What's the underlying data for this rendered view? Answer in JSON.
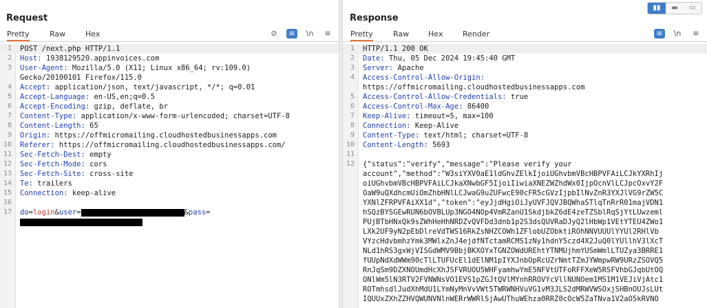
{
  "view_toggle": [
    {
      "name": "side-by-side-view-icon",
      "glyph": "▮▮",
      "active": true
    },
    {
      "name": "top-bottom-view-icon",
      "glyph": "▬",
      "active": false
    },
    {
      "name": "single-view-icon",
      "glyph": "▭",
      "active": false
    }
  ],
  "request": {
    "title": "Request",
    "tabs": [
      "Pretty",
      "Raw",
      "Hex"
    ],
    "active_tab": 0,
    "tools": [
      {
        "name": "hide-nonprintable-icon",
        "glyph": "⊘",
        "blue": false
      },
      {
        "name": "message-actions-icon",
        "glyph": "≡",
        "blue": true
      },
      {
        "name": "newline-toggle-icon",
        "glyph": "\\n",
        "blue": false
      },
      {
        "name": "menu-icon",
        "glyph": "≡",
        "blue": false
      }
    ],
    "lines": [
      {
        "n": "1",
        "parts": [
          {
            "t": "POST /next.php HTTP/1.1"
          }
        ],
        "hl": true
      },
      {
        "n": "2",
        "parts": [
          {
            "t": "Host:",
            "c": "key"
          },
          {
            "t": " 1938129520.appinvoices.com"
          }
        ]
      },
      {
        "n": "3",
        "parts": [
          {
            "t": "User-Agent:",
            "c": "key"
          },
          {
            "t": " Mozilla/5.0 (X11; Linux x86_64; rv:109.0)"
          }
        ]
      },
      {
        "n": "",
        "parts": [
          {
            "t": "Gecko/20100101 Firefox/115.0"
          }
        ]
      },
      {
        "n": "4",
        "parts": [
          {
            "t": "Accept:",
            "c": "key"
          },
          {
            "t": " application/json, text/javascript, */*; q=0.01"
          }
        ]
      },
      {
        "n": "5",
        "parts": [
          {
            "t": "Accept-Language:",
            "c": "key"
          },
          {
            "t": " en-US,en;q=0.5"
          }
        ]
      },
      {
        "n": "6",
        "parts": [
          {
            "t": "Accept-Encoding:",
            "c": "key"
          },
          {
            "t": " gzip, deflate, br"
          }
        ]
      },
      {
        "n": "7",
        "parts": [
          {
            "t": "Content-Type:",
            "c": "key"
          },
          {
            "t": " application/x-www-form-urlencoded; charset=UTF-8"
          }
        ]
      },
      {
        "n": "8",
        "parts": [
          {
            "t": "Content-Length:",
            "c": "key"
          },
          {
            "t": " 65"
          }
        ]
      },
      {
        "n": "9",
        "parts": [
          {
            "t": "Origin:",
            "c": "key"
          },
          {
            "t": " https://offmicromailing.cloudhostedbusinessapps.com"
          }
        ]
      },
      {
        "n": "10",
        "parts": [
          {
            "t": "Referer:",
            "c": "key"
          },
          {
            "t": " https://offmicromailing.cloudhostedbusinessapps.com/"
          }
        ]
      },
      {
        "n": "11",
        "parts": [
          {
            "t": "Sec-Fetch-Dest:",
            "c": "key"
          },
          {
            "t": " empty"
          }
        ]
      },
      {
        "n": "12",
        "parts": [
          {
            "t": "Sec-Fetch-Mode:",
            "c": "key"
          },
          {
            "t": " cors"
          }
        ]
      },
      {
        "n": "13",
        "parts": [
          {
            "t": "Sec-Fetch-Site:",
            "c": "key"
          },
          {
            "t": " cross-site"
          }
        ]
      },
      {
        "n": "14",
        "parts": [
          {
            "t": "Te:",
            "c": "key"
          },
          {
            "t": " trailers"
          }
        ]
      },
      {
        "n": "15",
        "parts": [
          {
            "t": "Connection:",
            "c": "key"
          },
          {
            "t": " keep-alive"
          }
        ]
      },
      {
        "n": "16",
        "parts": []
      },
      {
        "n": "17",
        "parts": [
          {
            "t": "do",
            "c": "key"
          },
          {
            "t": "="
          },
          {
            "t": "login",
            "c": "param"
          },
          {
            "t": "&"
          },
          {
            "t": "user",
            "c": "key"
          },
          {
            "t": "="
          },
          {
            "redact": 150
          },
          {
            "t": "&"
          },
          {
            "t": "pass",
            "c": "key"
          },
          {
            "t": "="
          }
        ]
      },
      {
        "n": "",
        "parts": [
          {
            "redact": 178
          }
        ]
      }
    ]
  },
  "response": {
    "title": "Response",
    "tabs": [
      "Pretty",
      "Raw",
      "Hex",
      "Render"
    ],
    "active_tab": 0,
    "tools": [
      {
        "name": "message-actions-icon",
        "glyph": "≡",
        "blue": true
      },
      {
        "name": "newline-toggle-icon",
        "glyph": "\\n",
        "blue": false
      },
      {
        "name": "menu-icon",
        "glyph": "≡",
        "blue": false
      }
    ],
    "lines": [
      {
        "n": "1",
        "parts": [
          {
            "t": "HTTP/1.1 200 OK"
          }
        ],
        "hl": true
      },
      {
        "n": "2",
        "parts": [
          {
            "t": "Date:",
            "c": "key"
          },
          {
            "t": " Thu, 05 Dec 2024 19:45:40 GMT"
          }
        ]
      },
      {
        "n": "3",
        "parts": [
          {
            "t": "Server:",
            "c": "key"
          },
          {
            "t": " Apache"
          }
        ]
      },
      {
        "n": "4",
        "parts": [
          {
            "t": "Access-Control-Allow-Origin:",
            "c": "key"
          }
        ]
      },
      {
        "n": "",
        "parts": [
          {
            "t": "https://offmicromailing.cloudhostedbusinessapps.com"
          }
        ]
      },
      {
        "n": "5",
        "parts": [
          {
            "t": "Access-Control-Allow-Credentials:",
            "c": "key"
          },
          {
            "t": " true"
          }
        ]
      },
      {
        "n": "6",
        "parts": [
          {
            "t": "Access-Control-Max-Age:",
            "c": "key"
          },
          {
            "t": " 86400"
          }
        ]
      },
      {
        "n": "7",
        "parts": [
          {
            "t": "Keep-Alive:",
            "c": "key"
          },
          {
            "t": " timeout=5, max=100"
          }
        ]
      },
      {
        "n": "8",
        "parts": [
          {
            "t": "Connection:",
            "c": "key"
          },
          {
            "t": " Keep-Alive"
          }
        ]
      },
      {
        "n": "9",
        "parts": [
          {
            "t": "Content-Type:",
            "c": "key"
          },
          {
            "t": " text/html; charset=UTF-8"
          }
        ]
      },
      {
        "n": "10",
        "parts": [
          {
            "t": "Content-Length:",
            "c": "key"
          },
          {
            "t": " 5693"
          }
        ]
      },
      {
        "n": "11",
        "parts": []
      },
      {
        "n": "12",
        "parts": [
          {
            "t": "{\"status\":\"verify\",\"message\":\"Please verify your"
          }
        ]
      },
      {
        "n": "",
        "parts": [
          {
            "t": "account\",\"method\":\"W3siYXV0aE1ldGhvZElkIjoiUGhvbmVBcHBPVFAiLCJkYXRhIj"
          }
        ]
      },
      {
        "n": "",
        "parts": [
          {
            "t": "oiUGhvbmVBcHBPVFAiLCJkaXNwbGF5IjoiIiwiaXNEZWZhdWx0IjpOcnVlLCJpcOxvY2F"
          }
        ]
      },
      {
        "n": "",
        "parts": [
          {
            "t": "OaW9uQXdhcmUiOmZhbHNlLCJwaG9uZUFwcE90cFR5cGVzIjpbIlNvZnR3YXJlVG9rZW5C"
          }
        ]
      },
      {
        "n": "",
        "parts": [
          {
            "t": "YXNlZFRPVFAiXX1d\",\"token\":\"eyJjdHgiOiJyUVFJQVJBQWhaSTlqTnRrR01majVDN1"
          }
        ]
      },
      {
        "n": "",
        "parts": [
          {
            "t": "hSQzBYSGEwRUN6bOVBLUp3NGO4NOp4VmRZanU1SkdjbkZ6dE4zeTZSblRqSjYtLUwzeml"
          }
        ]
      },
      {
        "n": "",
        "parts": [
          {
            "t": "PUjBTbHNxQk9sZWhHeHhNRDZvQVFDd3dnb1p2S3dsQUVRaDJyQ2lHbWp1VEtYTEU4ZWo1"
          }
        ]
      },
      {
        "n": "",
        "parts": [
          {
            "t": "LXk2UF9yN2pEbDlreVdTWS16RkZsNHZCOWh1ZFlobUZObktiROhNNVUUUlYYUl2RHlVb"
          }
        ]
      },
      {
        "n": "",
        "parts": [
          {
            "t": "VYzcHdvbmhzYmk3MWlxZnJ4ejdfNTctamRCMS1zNy1hdnY5czd4X2JuQ0lYUllhV3lXcT"
          }
        ]
      },
      {
        "n": "",
        "parts": [
          {
            "t": "NLd1hRS3gxWjVISGdWMV9BbjBKXOYxTGNZOWdUREhtYTNMUjhmYUSmWmlLTUZya3BRRE1"
          }
        ]
      },
      {
        "n": "",
        "parts": [
          {
            "t": "fUUpNdXdWWm90cTlLTUFUcEl1dElNM1pIYXJnbOpRcUZrNmtTZmJYWmpwRW9URzZSOVQ5"
          }
        ]
      },
      {
        "n": "",
        "parts": [
          {
            "t": "RnJqSm9DZXNOUmdHcXhJSFVRUOU5WHFyamhwYmE5NFVtUTFoRFFXeW5RSFVhbGJqbUtOQ"
          }
        ]
      },
      {
        "n": "",
        "parts": [
          {
            "t": "ONlWm5lN3RTV2FVNWNsVO1EVS1pZGJtQVlMYnhRROVYcVllNUNOem1MS1M1VEJiVjAtc1"
          }
        ]
      },
      {
        "n": "",
        "parts": [
          {
            "t": "ROTmhsdlJudXhMdU1LYmNyMnVvVWt5TWRWNHVuVG1vM3JLS2dMRWVWSOxjSHBnOUJsLUt"
          }
        ]
      },
      {
        "n": "",
        "parts": [
          {
            "t": "IQUUxZXhZZHVQWUNVNlnWERrWWRlSjAwUThuWEhza0RRZ0cOcW5ZaTNva1V2aO5kRVNO"
          }
        ]
      }
    ]
  }
}
